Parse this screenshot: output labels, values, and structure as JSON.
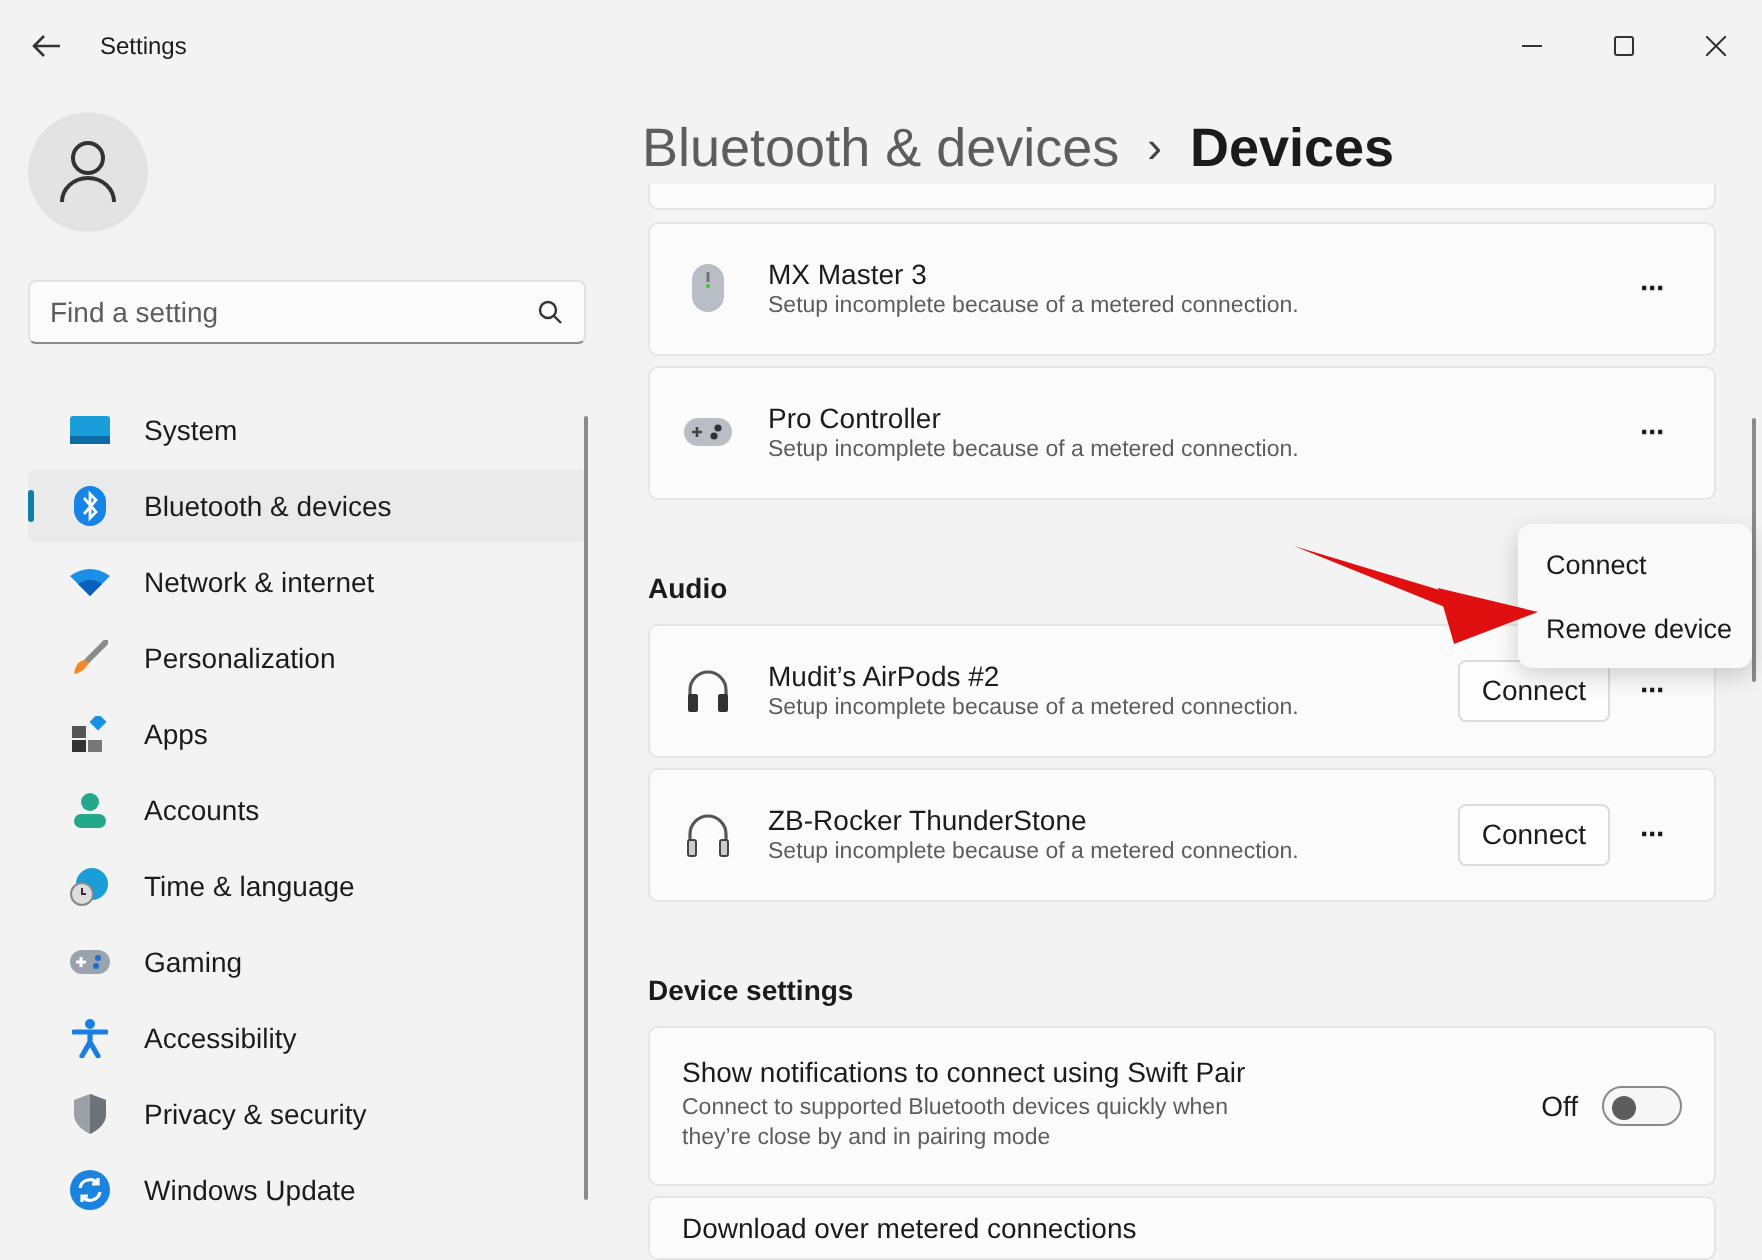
{
  "window": {
    "title": "Settings"
  },
  "search": {
    "placeholder": "Find a setting"
  },
  "sidebar": {
    "items": [
      {
        "label": "System",
        "selected": false
      },
      {
        "label": "Bluetooth & devices",
        "selected": true
      },
      {
        "label": "Network & internet",
        "selected": false
      },
      {
        "label": "Personalization",
        "selected": false
      },
      {
        "label": "Apps",
        "selected": false
      },
      {
        "label": "Accounts",
        "selected": false
      },
      {
        "label": "Time & language",
        "selected": false
      },
      {
        "label": "Gaming",
        "selected": false
      },
      {
        "label": "Accessibility",
        "selected": false
      },
      {
        "label": "Privacy & security",
        "selected": false
      },
      {
        "label": "Windows Update",
        "selected": false
      }
    ]
  },
  "breadcrumb": {
    "parent": "Bluetooth & devices",
    "separator": "›",
    "current": "Devices"
  },
  "sections": [
    {
      "devices": [
        {
          "name": "MX Master 3",
          "status": "Setup incomplete because of a metered connection.",
          "more": "···"
        },
        {
          "name": "Pro Controller",
          "status": "Setup incomplete because of a metered connection.",
          "more": "···"
        }
      ]
    },
    {
      "heading": "Audio",
      "devices": [
        {
          "name": "Mudit’s AirPods #2",
          "status": "Setup incomplete because of a metered connection.",
          "button": "Connect",
          "more": "···"
        },
        {
          "name": "ZB-Rocker ThunderStone",
          "status": "Setup incomplete because of a metered connection.",
          "button": "Connect",
          "more": "···"
        }
      ]
    }
  ],
  "device_settings": {
    "heading": "Device settings",
    "rows": [
      {
        "title": "Show notifications to connect using Swift Pair",
        "description": "Connect to supported Bluetooth devices quickly when they’re close by and in pairing mode",
        "toggle": {
          "on": false,
          "label": "Off"
        }
      },
      {
        "title": "Download over metered connections"
      }
    ]
  },
  "context_menu": {
    "items": [
      "Connect",
      "Remove device"
    ]
  }
}
